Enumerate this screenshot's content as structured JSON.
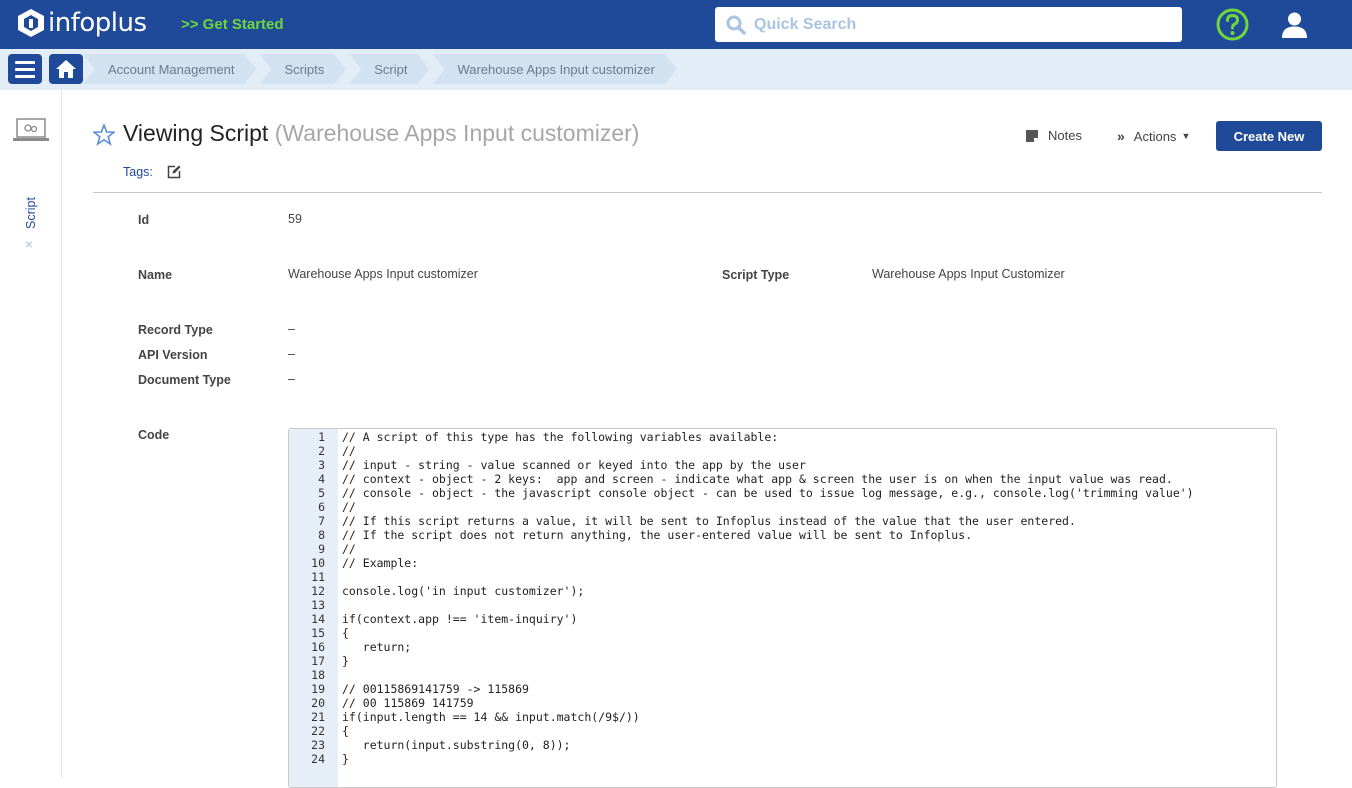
{
  "header": {
    "logo_text": "infoplus",
    "get_started": ">> Get Started",
    "search_placeholder": "Quick Search",
    "brand_color": "#1f4a99",
    "accent_green": "#6fd63b"
  },
  "breadcrumb": [
    "Account Management",
    "Scripts",
    "Script",
    "Warehouse Apps Input customizer"
  ],
  "siderail": {
    "tab_label": "Script",
    "close_glyph": "×"
  },
  "page": {
    "title": "Viewing Script",
    "subtitle": "(Warehouse Apps Input customizer)",
    "notes_label": "Notes",
    "actions_label": "Actions",
    "create_label": "Create New",
    "tags_label": "Tags:"
  },
  "fields": {
    "id": {
      "label": "Id",
      "value": "59"
    },
    "name": {
      "label": "Name",
      "value": "Warehouse Apps Input customizer"
    },
    "script_type": {
      "label": "Script Type",
      "value": "Warehouse Apps Input Customizer"
    },
    "record_type": {
      "label": "Record Type",
      "value": "–"
    },
    "api_version": {
      "label": "API Version",
      "value": "–"
    },
    "document_type": {
      "label": "Document Type",
      "value": "–"
    },
    "code": {
      "label": "Code"
    }
  },
  "code_lines": [
    "// A script of this type has the following variables available:",
    "//",
    "// input - string - value scanned or keyed into the app by the user",
    "// context - object - 2 keys:  app and screen - indicate what app & screen the user is on when the input value was read.",
    "// console - object - the javascript console object - can be used to issue log message, e.g., console.log('trimming value')",
    "//",
    "// If this script returns a value, it will be sent to Infoplus instead of the value that the user entered.",
    "// If the script does not return anything, the user-entered value will be sent to Infoplus.",
    "//",
    "// Example:",
    "",
    "console.log('in input customizer');",
    "",
    "if(context.app !== 'item-inquiry')",
    "{",
    "   return;",
    "}",
    "",
    "// 00115869141759 -> 115869",
    "// 00 115869 141759",
    "if(input.length == 14 && input.match(/9$/))",
    "{",
    "   return(input.substring(0, 8));",
    "}"
  ]
}
